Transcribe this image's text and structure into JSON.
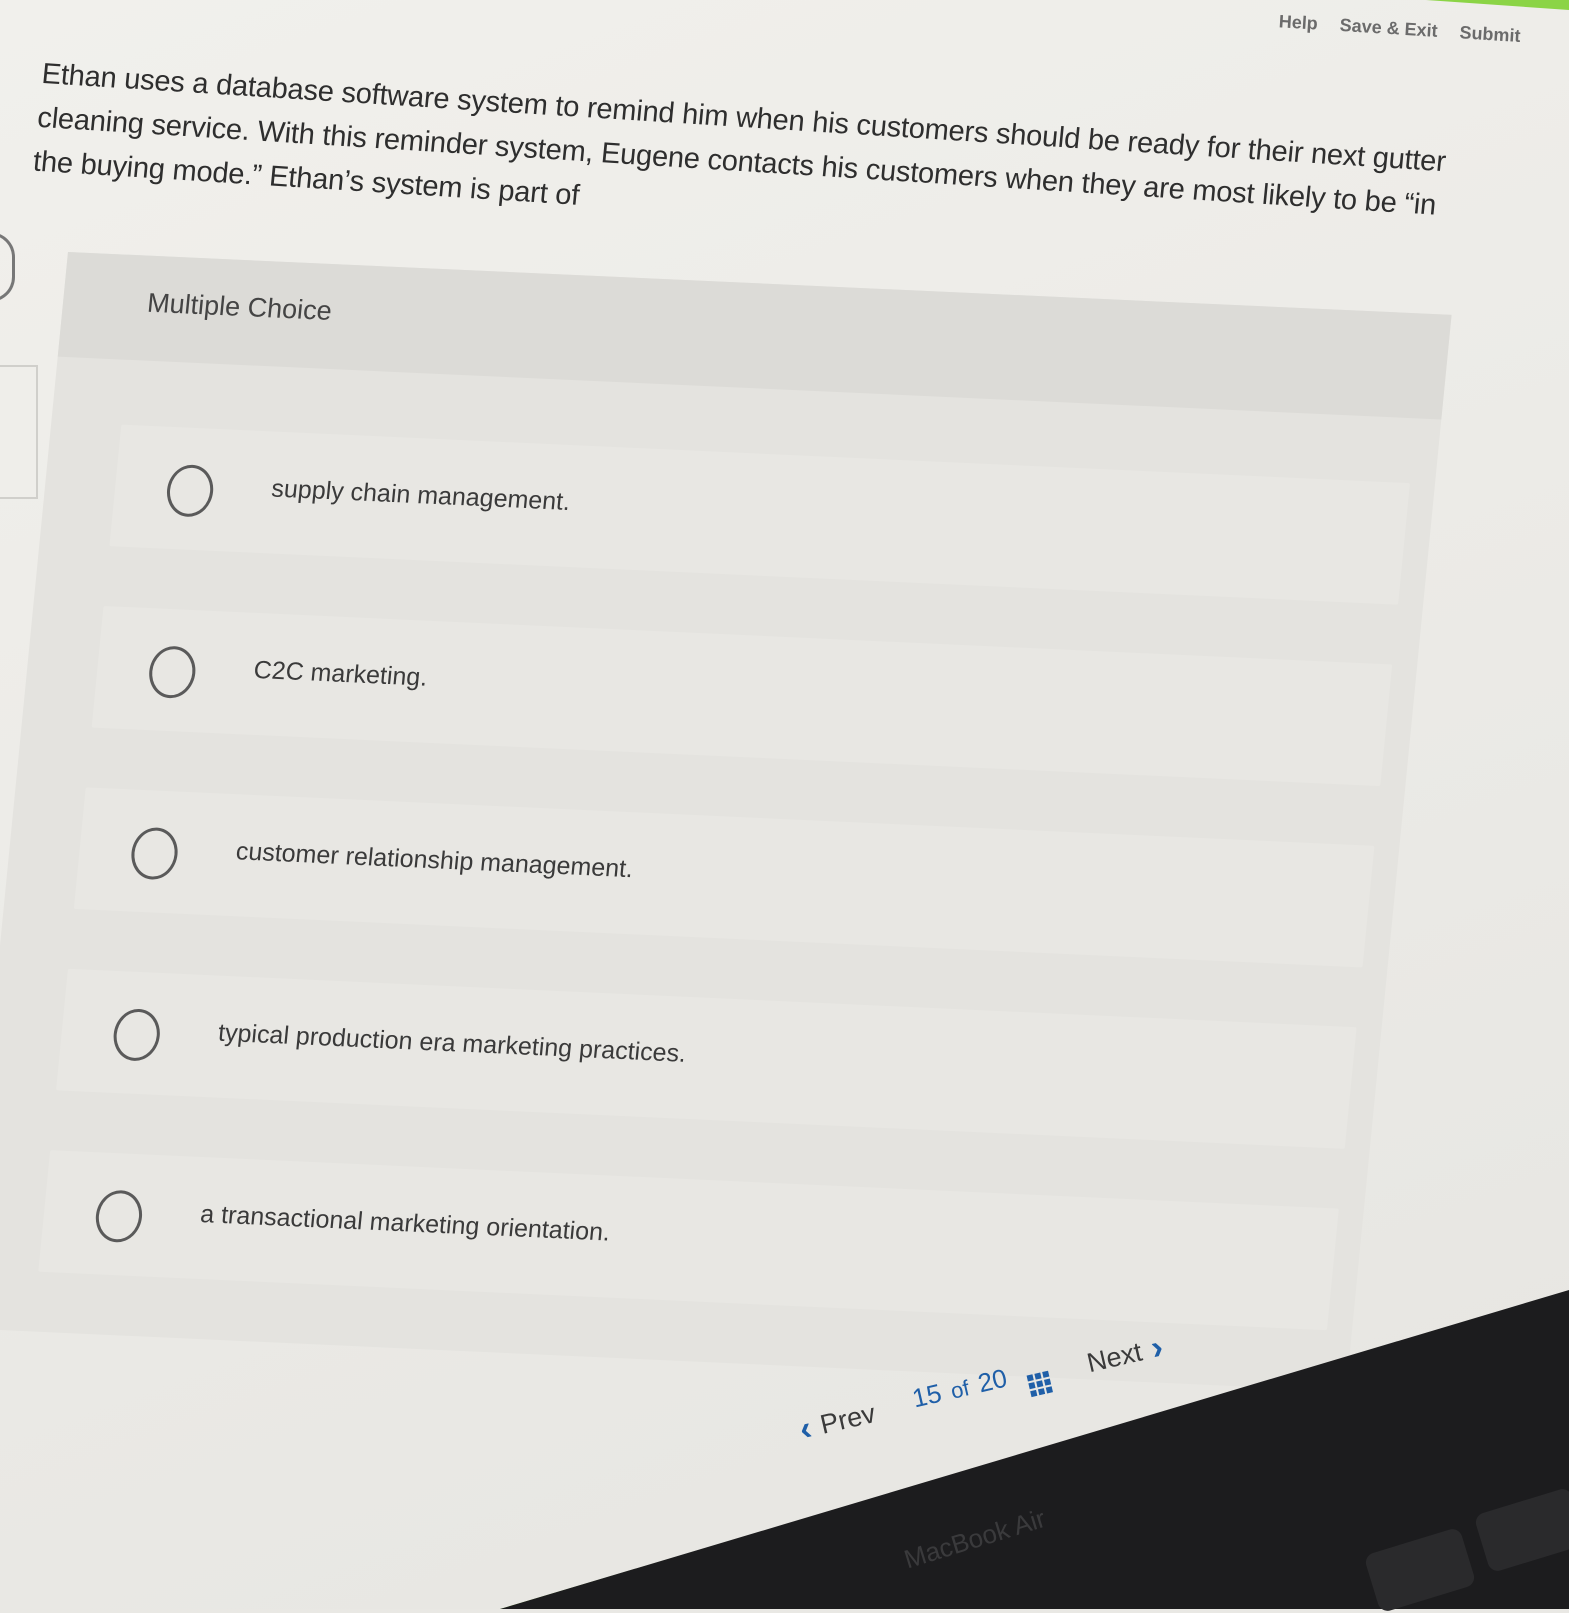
{
  "header": {
    "help": "Help",
    "save_exit": "Save & Exit",
    "submit": "Submit"
  },
  "question": {
    "text": "Ethan uses a database software system to remind him when his customers should be ready for their next gutter cleaning service. With this reminder system, Eugene contacts his customers when they are most likely to be “in the buying mode.” Ethan’s system is part of"
  },
  "panel": {
    "label": "Multiple Choice",
    "choices": [
      {
        "label": "supply chain management."
      },
      {
        "label": "C2C marketing."
      },
      {
        "label": "customer relationship management."
      },
      {
        "label": "typical production era marketing practices."
      },
      {
        "label": "a transactional marketing orientation."
      }
    ]
  },
  "nav": {
    "prev": "Prev",
    "current": "15",
    "of": "of",
    "total": "20",
    "next": "Next"
  },
  "device": {
    "brand_label": "MacBook Air"
  },
  "colors": {
    "accent_green": "#8bd446",
    "link_blue": "#1f5fa8"
  }
}
